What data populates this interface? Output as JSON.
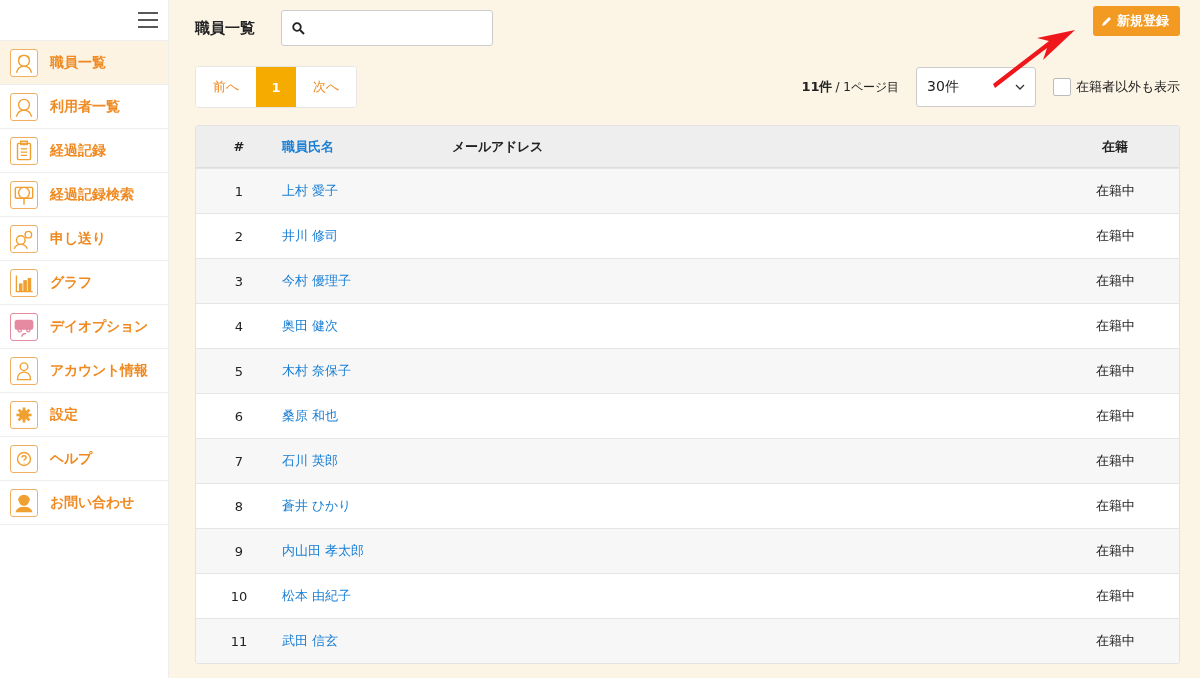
{
  "sidebar": {
    "items": [
      {
        "label": "職員一覧",
        "selected": true
      },
      {
        "label": "利用者一覧",
        "selected": false
      },
      {
        "label": "経過記録",
        "selected": false
      },
      {
        "label": "経過記録検索",
        "selected": false
      },
      {
        "label": "申し送り",
        "selected": false
      },
      {
        "label": "グラフ",
        "selected": false
      },
      {
        "label": "デイオプション",
        "selected": false
      },
      {
        "label": "アカウント情報",
        "selected": false
      },
      {
        "label": "設定",
        "selected": false
      },
      {
        "label": "ヘルプ",
        "selected": false
      },
      {
        "label": "お問い合わせ",
        "selected": false
      }
    ]
  },
  "page_title": "職員一覧",
  "new_button": "新規登録",
  "pagination": {
    "prev": "前へ",
    "pages": [
      {
        "label": "1",
        "selected": true
      }
    ],
    "next": "次へ"
  },
  "summary": {
    "count": "11件",
    "page": "/ 1ページ目"
  },
  "per_page": {
    "value": "30件"
  },
  "show_inactive": {
    "label": "在籍者以外も表示",
    "checked": false
  },
  "table": {
    "columns": [
      {
        "label": "#",
        "kind": "plain"
      },
      {
        "label": "職員氏名",
        "kind": "sort"
      },
      {
        "label": "メールアドレス",
        "kind": "plain"
      },
      {
        "label": "在籍",
        "kind": "plain"
      }
    ],
    "rows": [
      {
        "no": "1",
        "name": "上村 愛子",
        "status": "在籍中"
      },
      {
        "no": "2",
        "name": "井川 修司",
        "status": "在籍中"
      },
      {
        "no": "3",
        "name": "今村 優理子",
        "status": "在籍中"
      },
      {
        "no": "4",
        "name": "奥田 健次",
        "status": "在籍中"
      },
      {
        "no": "5",
        "name": "木村 奈保子",
        "status": "在籍中"
      },
      {
        "no": "6",
        "name": "桑原 和也",
        "status": "在籍中"
      },
      {
        "no": "7",
        "name": "石川 英郎",
        "status": "在籍中"
      },
      {
        "no": "8",
        "name": "蒼井 ひかり",
        "status": "在籍中"
      },
      {
        "no": "9",
        "name": "内山田 孝太郎",
        "status": "在籍中"
      },
      {
        "no": "10",
        "name": "松本 由紀子",
        "status": "在籍中"
      },
      {
        "no": "11",
        "name": "武田 信玄",
        "status": "在籍中"
      }
    ]
  }
}
